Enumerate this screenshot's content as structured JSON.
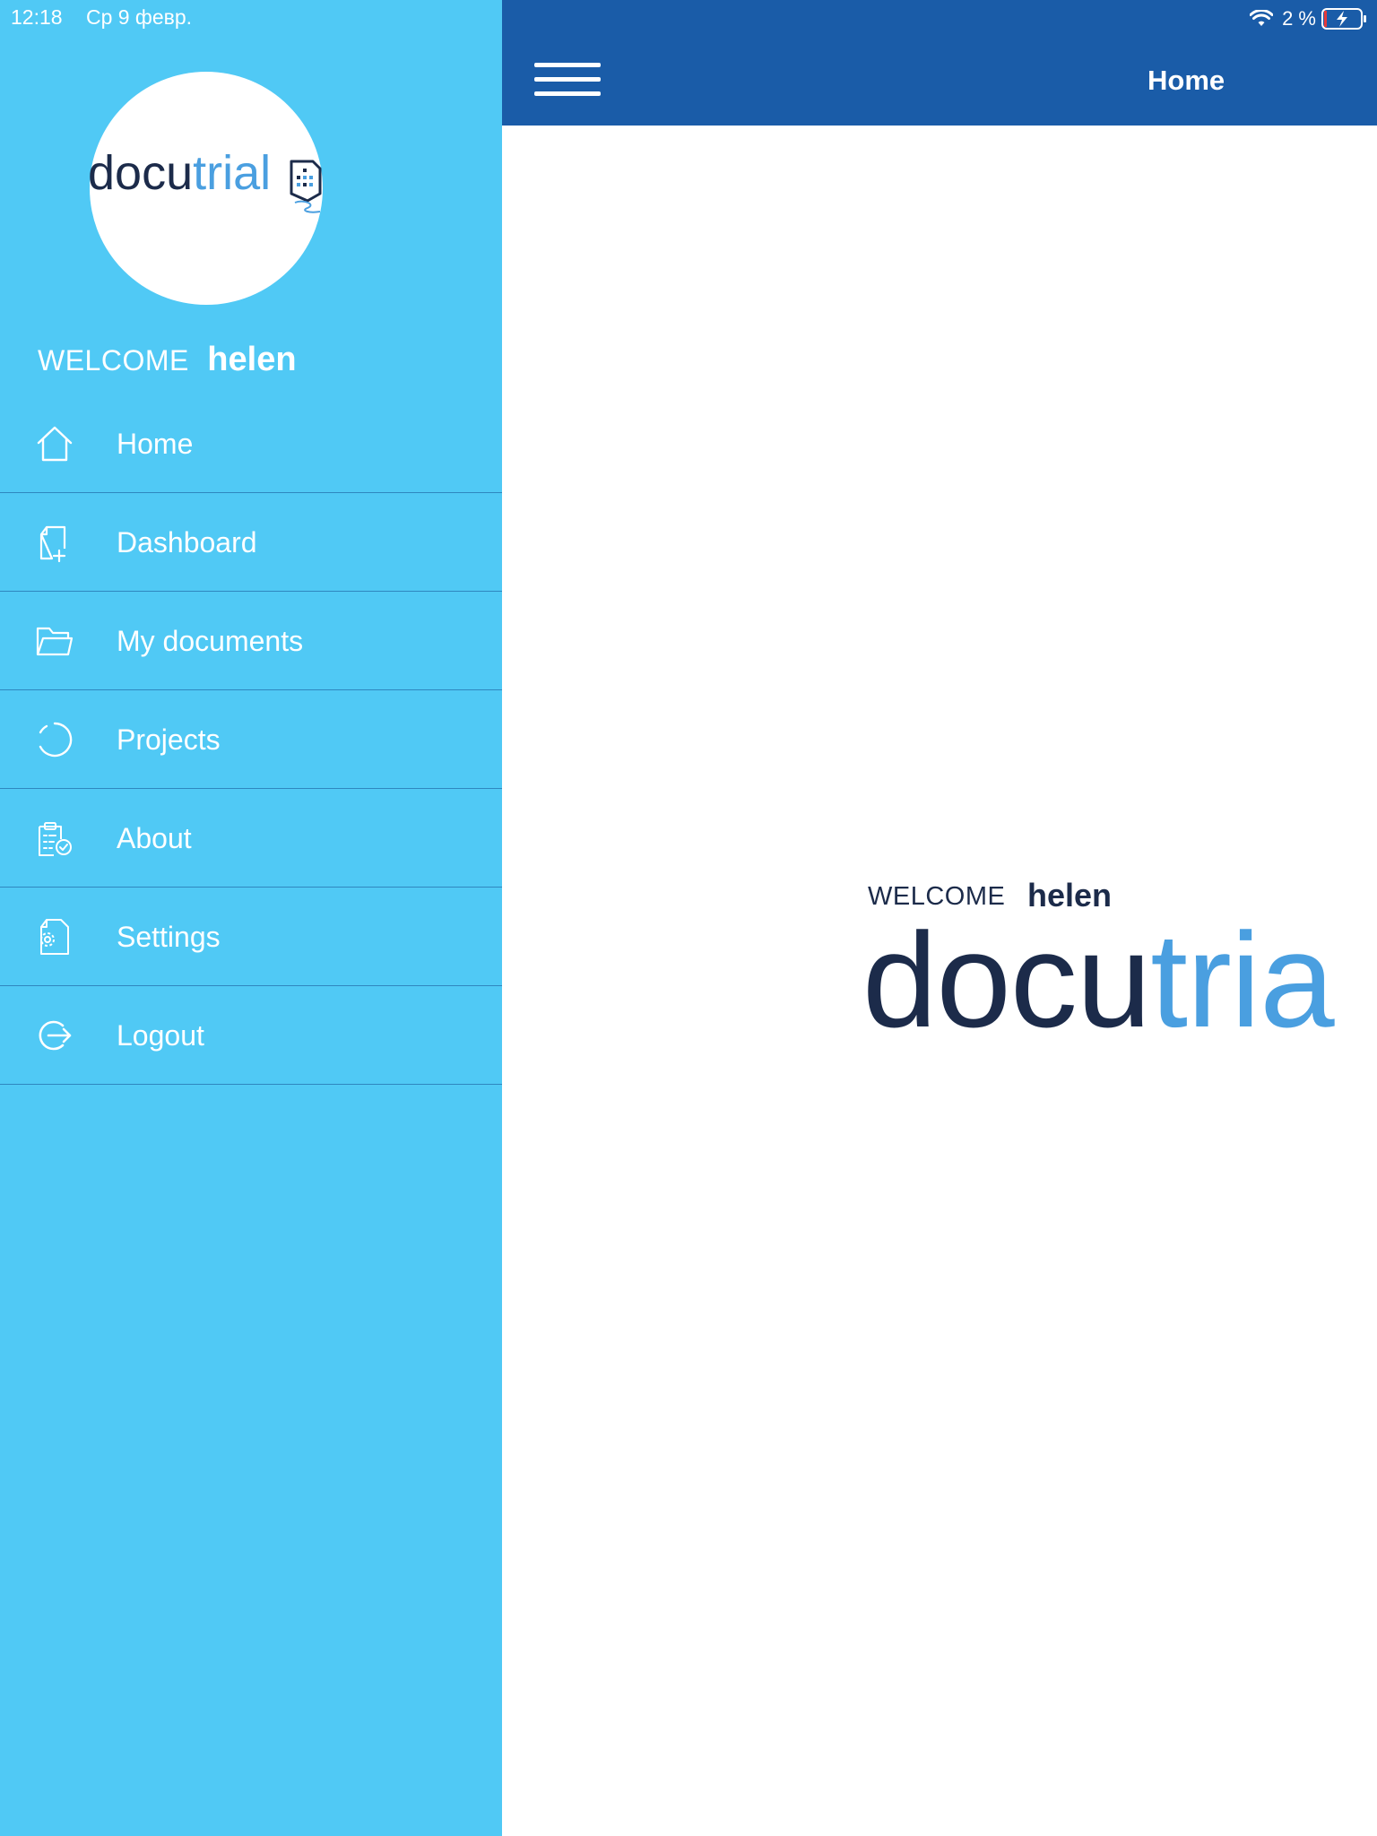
{
  "status_bar": {
    "time": "12:18",
    "date": "Ср 9 февр.",
    "battery": "2 %"
  },
  "header": {
    "title": "Home"
  },
  "sidebar": {
    "logo": {
      "dark": "docu",
      "light": "trial"
    },
    "welcome_label": "WELCOME",
    "user_name": "helen",
    "items": [
      {
        "label": "Home",
        "icon": "home-icon"
      },
      {
        "label": "Dashboard",
        "icon": "document-add-icon"
      },
      {
        "label": "My documents",
        "icon": "folder-icon"
      },
      {
        "label": "Projects",
        "icon": "spinner-icon"
      },
      {
        "label": "About",
        "icon": "checklist-icon"
      },
      {
        "label": "Settings",
        "icon": "settings-file-icon"
      },
      {
        "label": "Logout",
        "icon": "logout-icon"
      }
    ]
  },
  "main": {
    "welcome_label": "WELCOME",
    "user_name": "helen",
    "logo": {
      "dark": "docu",
      "light": "tria"
    }
  },
  "colors": {
    "sidebar_bg": "#50c9f5",
    "header_bg": "#1a5ca8",
    "logo_dark": "#1c2b4a",
    "logo_light": "#4a9fe0",
    "divider": "#2f87bf"
  }
}
